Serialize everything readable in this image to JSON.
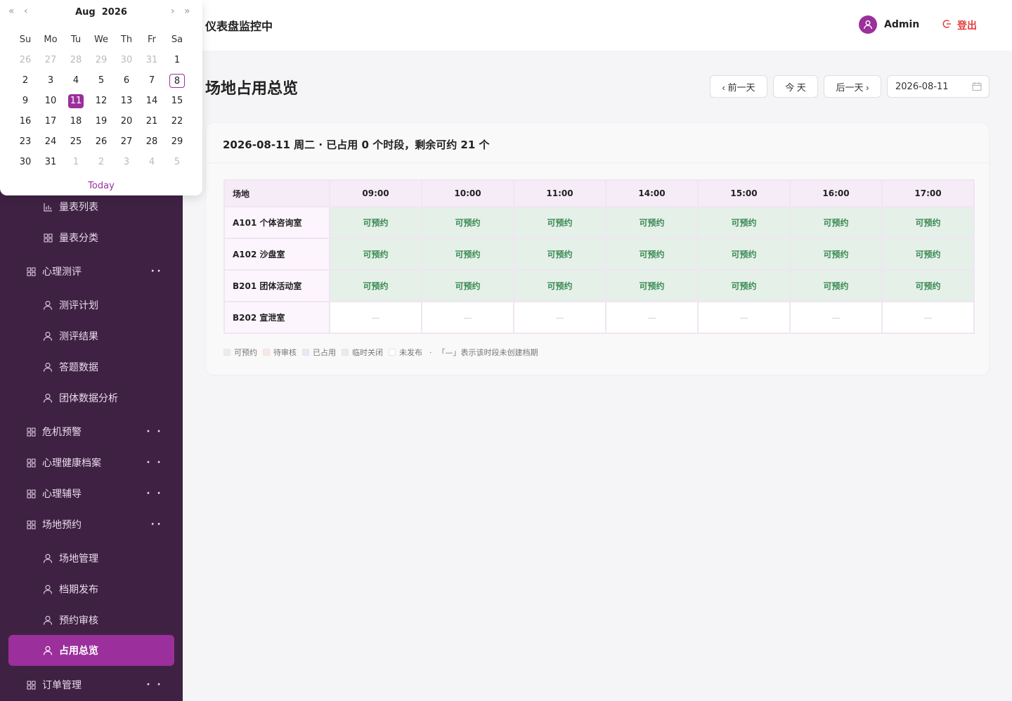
{
  "header": {
    "app_title": "仪表盘监控中",
    "user_name": "Admin",
    "logout_label": "登出"
  },
  "sidebar": {
    "items": [
      {
        "label": "量表列表",
        "level": "sub",
        "icon": "chart-icon"
      },
      {
        "label": "量表分类",
        "level": "sub",
        "icon": "grid-icon"
      },
      {
        "label": "心理测评",
        "level": "top",
        "icon": "grid-icon",
        "expanded": true
      },
      {
        "label": "测评计划",
        "level": "sub",
        "icon": "user-icon"
      },
      {
        "label": "测评结果",
        "level": "sub",
        "icon": "user-icon"
      },
      {
        "label": "答题数据",
        "level": "sub",
        "icon": "user-icon"
      },
      {
        "label": "团体数据分析",
        "level": "sub",
        "icon": "user-icon"
      },
      {
        "label": "危机预警",
        "level": "top",
        "icon": "grid-icon",
        "expanded": false
      },
      {
        "label": "心理健康档案",
        "level": "top",
        "icon": "grid-icon",
        "expanded": false
      },
      {
        "label": "心理辅导",
        "level": "top",
        "icon": "grid-icon",
        "expanded": false
      },
      {
        "label": "场地预约",
        "level": "top",
        "icon": "grid-icon",
        "expanded": true
      },
      {
        "label": "场地管理",
        "level": "sub",
        "icon": "user-icon"
      },
      {
        "label": "档期发布",
        "level": "sub",
        "icon": "user-icon"
      },
      {
        "label": "预约审核",
        "level": "sub",
        "icon": "user-icon"
      },
      {
        "label": "占用总览",
        "level": "sub",
        "icon": "user-icon",
        "active": true
      },
      {
        "label": "订单管理",
        "level": "top",
        "icon": "grid-icon",
        "expanded": false
      }
    ]
  },
  "page": {
    "title": "场地占用总览",
    "prev_label": "‹ 前一天",
    "today_label": "今 天",
    "next_label": "后一天 ›",
    "date_value": "2026-08-11"
  },
  "card": {
    "summary": "2026-08-11 周二 · 已占用 0 个时段，剩余可约 21 个"
  },
  "table": {
    "room_header": "场地",
    "times": [
      "09:00",
      "10:00",
      "11:00",
      "14:00",
      "15:00",
      "16:00",
      "17:00"
    ],
    "rows": [
      {
        "room": "A101 个体咨询室",
        "status": "avail",
        "cells": [
          "可预约",
          "可预约",
          "可预约",
          "可预约",
          "可预约",
          "可预约",
          "可预约"
        ]
      },
      {
        "room": "A102 沙盘室",
        "status": "avail",
        "cells": [
          "可预约",
          "可预约",
          "可预约",
          "可预约",
          "可预约",
          "可预约",
          "可预约"
        ]
      },
      {
        "room": "B201 团体活动室",
        "status": "avail",
        "cells": [
          "可预约",
          "可预约",
          "可预约",
          "可预约",
          "可预约",
          "可预约",
          "可预约"
        ]
      },
      {
        "room": "B202 宣泄室",
        "status": "none",
        "cells": [
          "—",
          "—",
          "—",
          "—",
          "—",
          "—",
          "—"
        ]
      }
    ]
  },
  "legend": {
    "items": [
      {
        "label": "可预约",
        "color": "#e5f0e8"
      },
      {
        "label": "待审核",
        "color": "#fbe7e0"
      },
      {
        "label": "已占用",
        "color": "#e8e8f8"
      },
      {
        "label": "临时关闭",
        "color": "#efe8ef"
      },
      {
        "label": "未发布",
        "color": "#ffffff"
      }
    ],
    "separator": "·",
    "note": "「—」表示该时段未创建档期"
  },
  "picker": {
    "month": "Aug",
    "year": "2026",
    "weekdays": [
      "Su",
      "Mo",
      "Tu",
      "We",
      "Th",
      "Fr",
      "Sa"
    ],
    "weeks": [
      [
        {
          "d": "26",
          "m": true
        },
        {
          "d": "27",
          "m": true
        },
        {
          "d": "28",
          "m": true
        },
        {
          "d": "29",
          "m": true
        },
        {
          "d": "30",
          "m": true
        },
        {
          "d": "31",
          "m": true
        },
        {
          "d": "1"
        }
      ],
      [
        {
          "d": "2"
        },
        {
          "d": "3"
        },
        {
          "d": "4"
        },
        {
          "d": "5"
        },
        {
          "d": "6"
        },
        {
          "d": "7"
        },
        {
          "d": "8",
          "today": true
        }
      ],
      [
        {
          "d": "9"
        },
        {
          "d": "10"
        },
        {
          "d": "11",
          "sel": true
        },
        {
          "d": "12"
        },
        {
          "d": "13"
        },
        {
          "d": "14"
        },
        {
          "d": "15"
        }
      ],
      [
        {
          "d": "16"
        },
        {
          "d": "17"
        },
        {
          "d": "18"
        },
        {
          "d": "19"
        },
        {
          "d": "20"
        },
        {
          "d": "21"
        },
        {
          "d": "22"
        }
      ],
      [
        {
          "d": "23"
        },
        {
          "d": "24"
        },
        {
          "d": "25"
        },
        {
          "d": "26"
        },
        {
          "d": "27"
        },
        {
          "d": "28"
        },
        {
          "d": "29"
        }
      ],
      [
        {
          "d": "30"
        },
        {
          "d": "31"
        },
        {
          "d": "1",
          "m": true
        },
        {
          "d": "2",
          "m": true
        },
        {
          "d": "3",
          "m": true
        },
        {
          "d": "4",
          "m": true
        },
        {
          "d": "5",
          "m": true
        }
      ]
    ],
    "today_label": "Today"
  },
  "colors": {
    "accent": "#9b2f9b",
    "sidebar_bg": "#3f2243",
    "logout": "#e4403f",
    "available_text": "#3c8a55"
  }
}
